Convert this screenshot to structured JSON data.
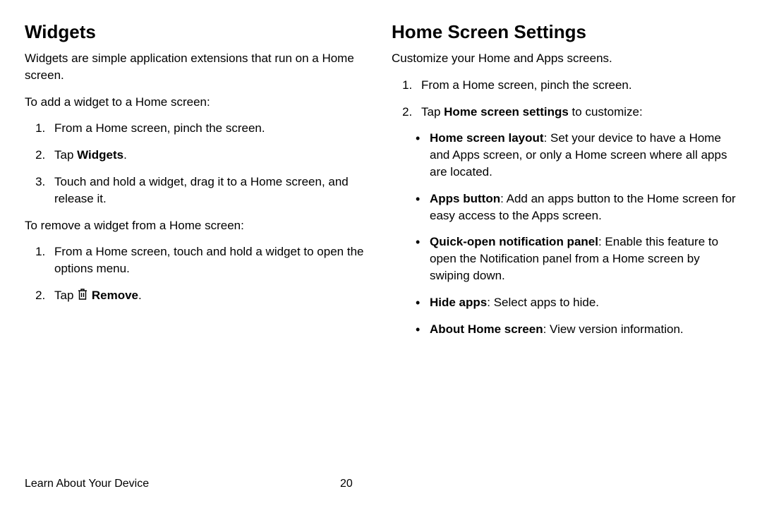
{
  "left": {
    "heading": "Widgets",
    "intro": "Widgets are simple application extensions that run on a Home screen.",
    "addIntro": "To add a widget to a Home screen:",
    "addStep1": "From a Home screen, pinch the screen.",
    "addStep2Tap": "Tap ",
    "addStep2Bold": "Widgets",
    "addStep2End": ".",
    "addStep3": "Touch and hold a widget, drag it to a Home screen, and release it.",
    "removeIntro": "To remove a widget from a Home screen:",
    "removeStep1": "From a Home screen, touch and hold a widget to open the options menu.",
    "removeStep2Tap": "Tap ",
    "removeStep2Bold": " Remove",
    "removeStep2End": "."
  },
  "right": {
    "heading": "Home Screen Settings",
    "intro": "Customize your Home and Apps screens.",
    "step1": "From a Home screen, pinch the screen.",
    "step2Tap": "Tap ",
    "step2Bold": "Home screen settings",
    "step2End": " to customize:",
    "bullet1Bold": "Home screen layout",
    "bullet1Text": ": Set your device to have a Home and Apps screen, or only a Home screen where all apps are located.",
    "bullet2Bold": "Apps button",
    "bullet2Text": ": Add an apps button to the Home screen for easy access to the Apps screen.",
    "bullet3Bold": "Quick-open notification panel",
    "bullet3Text": ": Enable this feature to open the Notification panel from a Home screen by swiping down.",
    "bullet4Bold": "Hide apps",
    "bullet4Text": ": Select apps to hide.",
    "bullet5Bold": "About Home screen",
    "bullet5Text": ": View version information."
  },
  "footer": {
    "section": "Learn About Your Device",
    "page": "20"
  }
}
